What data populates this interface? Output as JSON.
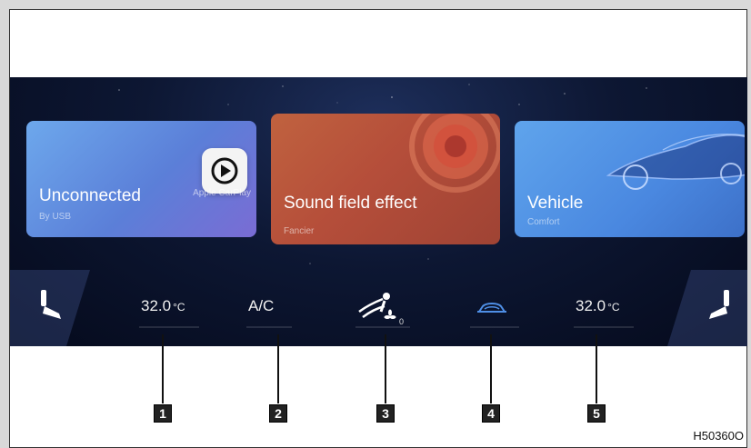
{
  "cards": {
    "carplay": {
      "title": "Unconnected",
      "subtitle": "By USB",
      "brand": "Apple CarPlay"
    },
    "sound": {
      "title": "Sound field effect",
      "subtitle": "Fancier"
    },
    "vehicle": {
      "title": "Vehicle",
      "subtitle": "Comfort"
    }
  },
  "climate": {
    "left_temp": {
      "value": "32.0",
      "unit": "°C"
    },
    "ac_label": "A/C",
    "fan_level": "0",
    "right_temp": {
      "value": "32.0",
      "unit": "°C"
    }
  },
  "callouts": [
    "1",
    "2",
    "3",
    "4",
    "5"
  ],
  "figure_code": "H50360O",
  "colors": {
    "screen_bg": "#0d1733",
    "recirc_icon": "#4f8fe6",
    "carplay_card": "#6da8ec",
    "sound_card": "#b54e3a",
    "vehicle_card": "#4a88e0"
  }
}
